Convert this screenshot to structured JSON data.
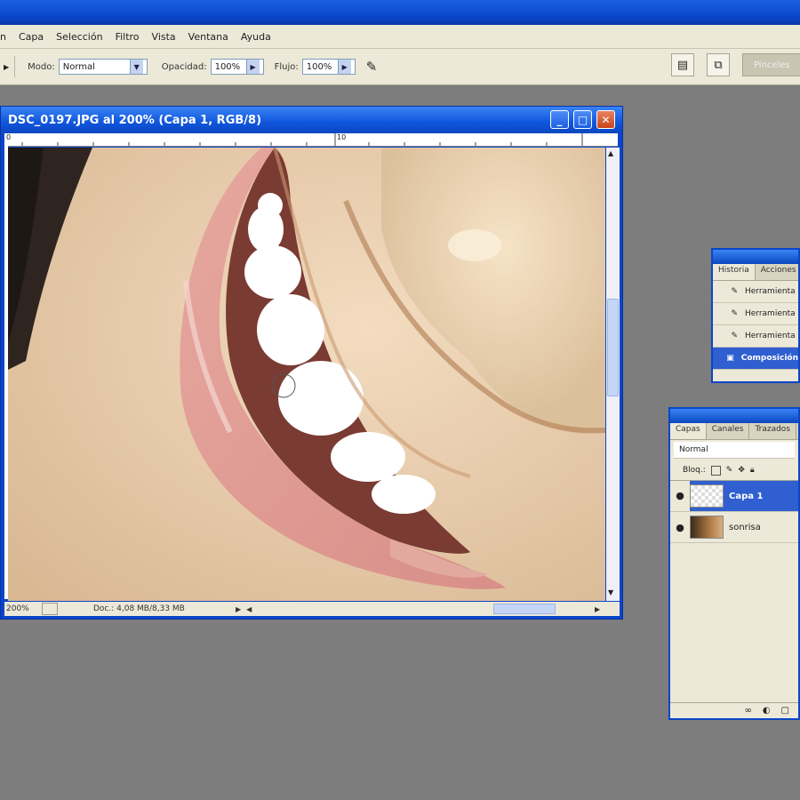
{
  "menu": {
    "items": [
      "n",
      "Capa",
      "Selección",
      "Filtro",
      "Vista",
      "Ventana",
      "Ayuda"
    ]
  },
  "options": {
    "mode_label": "Modo:",
    "mode_value": "Normal",
    "opacity_label": "Opacidad:",
    "opacity_value": "100%",
    "flow_label": "Flujo:",
    "flow_value": "100%",
    "right_button_label": "Pinceles"
  },
  "document": {
    "title": "DSC_0197.JPG al 200% (Capa 1, RGB/8)",
    "zoom_status": "200%",
    "doc_status": "Doc.: 4,08 MB/8,33 MB",
    "ruler_labels": [
      "0",
      "10"
    ]
  },
  "history_panel": {
    "tabs": [
      "Historia",
      "Acciones"
    ],
    "rows": [
      "Herramienta",
      "Herramienta",
      "Herramienta",
      "Composición"
    ]
  },
  "layers_panel": {
    "tabs": [
      "Capas",
      "Canales",
      "Trazados"
    ],
    "blend_mode": "Normal",
    "lock_label": "Bloq.:",
    "layers": [
      "Capa 1",
      "sonrisa"
    ]
  },
  "colors": {
    "titlebar_blue": "#0a45c9",
    "selection_blue": "#2f5fd0",
    "chrome": "#ece9d8",
    "workspace": "#7d7d7d"
  }
}
